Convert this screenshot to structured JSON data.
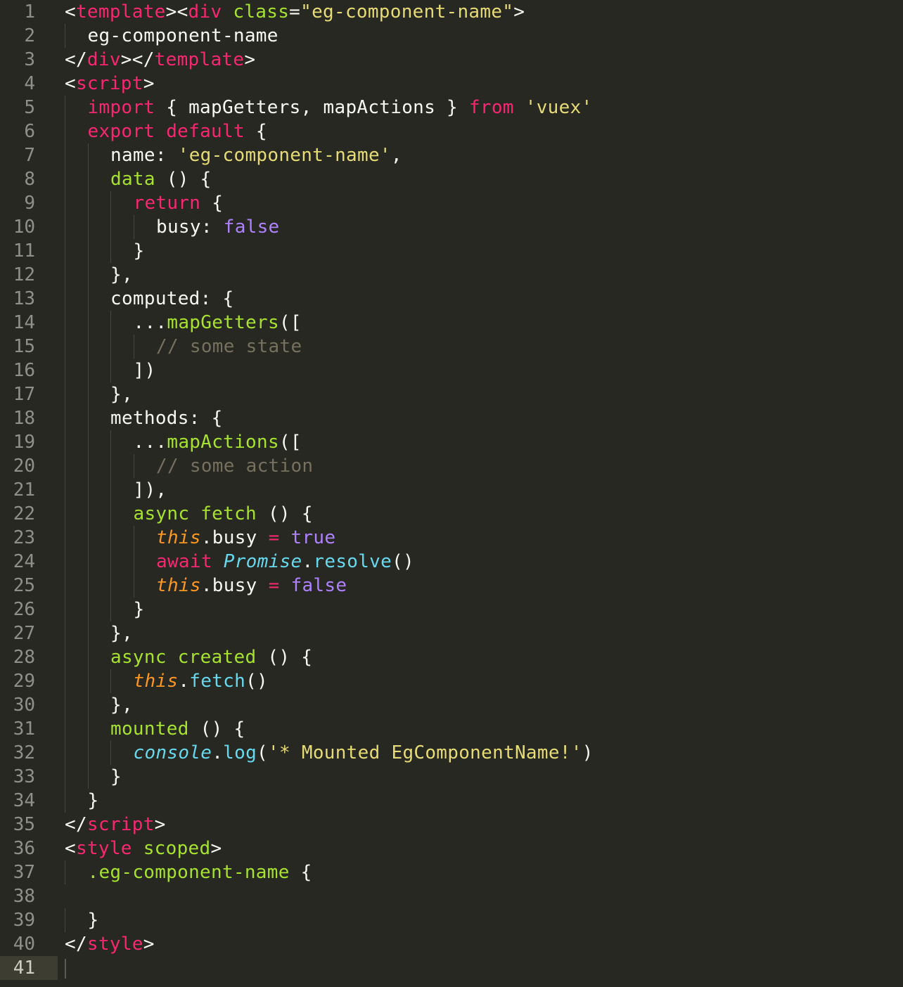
{
  "editor": {
    "current_line": 41,
    "lines": [
      {
        "n": "1",
        "indent": 0,
        "tokens": [
          {
            "t": "<",
            "c": "white"
          },
          {
            "t": "template",
            "c": "pink"
          },
          {
            "t": "><",
            "c": "white"
          },
          {
            "t": "div",
            "c": "pink"
          },
          {
            "t": " ",
            "c": "white"
          },
          {
            "t": "class",
            "c": "green"
          },
          {
            "t": "=",
            "c": "white"
          },
          {
            "t": "\"eg-component-name\"",
            "c": "yellow"
          },
          {
            "t": ">",
            "c": "white"
          }
        ]
      },
      {
        "n": "2",
        "indent": 1,
        "tokens": [
          {
            "t": "eg-component-name",
            "c": "white"
          }
        ]
      },
      {
        "n": "3",
        "indent": 0,
        "tokens": [
          {
            "t": "</",
            "c": "white"
          },
          {
            "t": "div",
            "c": "pink"
          },
          {
            "t": "></",
            "c": "white"
          },
          {
            "t": "template",
            "c": "pink"
          },
          {
            "t": ">",
            "c": "white"
          }
        ]
      },
      {
        "n": "4",
        "indent": 0,
        "tokens": [
          {
            "t": "<",
            "c": "white"
          },
          {
            "t": "script",
            "c": "pink"
          },
          {
            "t": ">",
            "c": "white"
          }
        ]
      },
      {
        "n": "5",
        "indent": 1,
        "tokens": [
          {
            "t": "import",
            "c": "pink"
          },
          {
            "t": " { mapGetters, mapActions } ",
            "c": "white"
          },
          {
            "t": "from",
            "c": "pink"
          },
          {
            "t": " ",
            "c": "white"
          },
          {
            "t": "'vuex'",
            "c": "yellow"
          }
        ]
      },
      {
        "n": "6",
        "indent": 1,
        "tokens": [
          {
            "t": "export",
            "c": "pink"
          },
          {
            "t": " ",
            "c": "white"
          },
          {
            "t": "default",
            "c": "pink"
          },
          {
            "t": " {",
            "c": "white"
          }
        ]
      },
      {
        "n": "7",
        "indent": 2,
        "tokens": [
          {
            "t": "name: ",
            "c": "white"
          },
          {
            "t": "'eg-component-name'",
            "c": "yellow"
          },
          {
            "t": ",",
            "c": "white"
          }
        ]
      },
      {
        "n": "8",
        "indent": 2,
        "tokens": [
          {
            "t": "data",
            "c": "green"
          },
          {
            "t": " () {",
            "c": "white"
          }
        ]
      },
      {
        "n": "9",
        "indent": 3,
        "tokens": [
          {
            "t": "return",
            "c": "pink"
          },
          {
            "t": " {",
            "c": "white"
          }
        ]
      },
      {
        "n": "10",
        "indent": 4,
        "tokens": [
          {
            "t": "busy: ",
            "c": "white"
          },
          {
            "t": "false",
            "c": "purple"
          }
        ]
      },
      {
        "n": "11",
        "indent": 3,
        "tokens": [
          {
            "t": "}",
            "c": "white"
          }
        ]
      },
      {
        "n": "12",
        "indent": 2,
        "tokens": [
          {
            "t": "},",
            "c": "white"
          }
        ]
      },
      {
        "n": "13",
        "indent": 2,
        "tokens": [
          {
            "t": "computed: {",
            "c": "white"
          }
        ]
      },
      {
        "n": "14",
        "indent": 3,
        "tokens": [
          {
            "t": "...",
            "c": "white"
          },
          {
            "t": "mapGetters",
            "c": "green"
          },
          {
            "t": "([",
            "c": "white"
          }
        ]
      },
      {
        "n": "15",
        "indent": 4,
        "tokens": [
          {
            "t": "// some state",
            "c": "comment"
          }
        ]
      },
      {
        "n": "16",
        "indent": 3,
        "tokens": [
          {
            "t": "])",
            "c": "white"
          }
        ]
      },
      {
        "n": "17",
        "indent": 2,
        "tokens": [
          {
            "t": "},",
            "c": "white"
          }
        ]
      },
      {
        "n": "18",
        "indent": 2,
        "tokens": [
          {
            "t": "methods: {",
            "c": "white"
          }
        ]
      },
      {
        "n": "19",
        "indent": 3,
        "tokens": [
          {
            "t": "...",
            "c": "white"
          },
          {
            "t": "mapActions",
            "c": "green"
          },
          {
            "t": "([",
            "c": "white"
          }
        ]
      },
      {
        "n": "20",
        "indent": 4,
        "tokens": [
          {
            "t": "// some action",
            "c": "comment"
          }
        ]
      },
      {
        "n": "21",
        "indent": 3,
        "tokens": [
          {
            "t": "]),",
            "c": "white"
          }
        ]
      },
      {
        "n": "22",
        "indent": 3,
        "tokens": [
          {
            "t": "async fetch",
            "c": "green"
          },
          {
            "t": " () {",
            "c": "white"
          }
        ]
      },
      {
        "n": "23",
        "indent": 4,
        "tokens": [
          {
            "t": "this",
            "c": "orange"
          },
          {
            "t": ".busy ",
            "c": "white"
          },
          {
            "t": "=",
            "c": "pink"
          },
          {
            "t": " ",
            "c": "white"
          },
          {
            "t": "true",
            "c": "purple"
          }
        ]
      },
      {
        "n": "24",
        "indent": 4,
        "tokens": [
          {
            "t": "await",
            "c": "pink"
          },
          {
            "t": " ",
            "c": "white"
          },
          {
            "t": "Promise",
            "c": "cyanit"
          },
          {
            "t": ".",
            "c": "white"
          },
          {
            "t": "resolve",
            "c": "cyan"
          },
          {
            "t": "()",
            "c": "white"
          }
        ]
      },
      {
        "n": "25",
        "indent": 4,
        "tokens": [
          {
            "t": "this",
            "c": "orange"
          },
          {
            "t": ".busy ",
            "c": "white"
          },
          {
            "t": "=",
            "c": "pink"
          },
          {
            "t": " ",
            "c": "white"
          },
          {
            "t": "false",
            "c": "purple"
          }
        ]
      },
      {
        "n": "26",
        "indent": 3,
        "tokens": [
          {
            "t": "}",
            "c": "white"
          }
        ]
      },
      {
        "n": "27",
        "indent": 2,
        "tokens": [
          {
            "t": "},",
            "c": "white"
          }
        ]
      },
      {
        "n": "28",
        "indent": 2,
        "tokens": [
          {
            "t": "async created",
            "c": "green"
          },
          {
            "t": " () {",
            "c": "white"
          }
        ]
      },
      {
        "n": "29",
        "indent": 3,
        "tokens": [
          {
            "t": "this",
            "c": "orange"
          },
          {
            "t": ".",
            "c": "white"
          },
          {
            "t": "fetch",
            "c": "cyan"
          },
          {
            "t": "()",
            "c": "white"
          }
        ]
      },
      {
        "n": "30",
        "indent": 2,
        "tokens": [
          {
            "t": "},",
            "c": "white"
          }
        ]
      },
      {
        "n": "31",
        "indent": 2,
        "tokens": [
          {
            "t": "mounted",
            "c": "green"
          },
          {
            "t": " () {",
            "c": "white"
          }
        ]
      },
      {
        "n": "32",
        "indent": 3,
        "tokens": [
          {
            "t": "console",
            "c": "cyanit"
          },
          {
            "t": ".",
            "c": "white"
          },
          {
            "t": "log",
            "c": "cyan"
          },
          {
            "t": "(",
            "c": "white"
          },
          {
            "t": "'* Mounted EgComponentName!'",
            "c": "yellow"
          },
          {
            "t": ")",
            "c": "white"
          }
        ]
      },
      {
        "n": "33",
        "indent": 2,
        "tokens": [
          {
            "t": "}",
            "c": "white"
          }
        ]
      },
      {
        "n": "34",
        "indent": 1,
        "tokens": [
          {
            "t": "}",
            "c": "white"
          }
        ]
      },
      {
        "n": "35",
        "indent": 0,
        "tokens": [
          {
            "t": "</",
            "c": "white"
          },
          {
            "t": "script",
            "c": "pink"
          },
          {
            "t": ">",
            "c": "white"
          }
        ]
      },
      {
        "n": "36",
        "indent": 0,
        "tokens": [
          {
            "t": "<",
            "c": "white"
          },
          {
            "t": "style",
            "c": "pink"
          },
          {
            "t": " ",
            "c": "white"
          },
          {
            "t": "scoped",
            "c": "green"
          },
          {
            "t": ">",
            "c": "white"
          }
        ]
      },
      {
        "n": "37",
        "indent": 1,
        "tokens": [
          {
            "t": ".eg-component-name",
            "c": "green"
          },
          {
            "t": " {",
            "c": "white"
          }
        ]
      },
      {
        "n": "38",
        "indent": 0,
        "tokens": []
      },
      {
        "n": "39",
        "indent": 1,
        "tokens": [
          {
            "t": "}",
            "c": "white"
          }
        ]
      },
      {
        "n": "40",
        "indent": 0,
        "tokens": [
          {
            "t": "</",
            "c": "white"
          },
          {
            "t": "style",
            "c": "pink"
          },
          {
            "t": ">",
            "c": "white"
          }
        ]
      },
      {
        "n": "41",
        "indent": 0,
        "tokens": []
      }
    ]
  }
}
